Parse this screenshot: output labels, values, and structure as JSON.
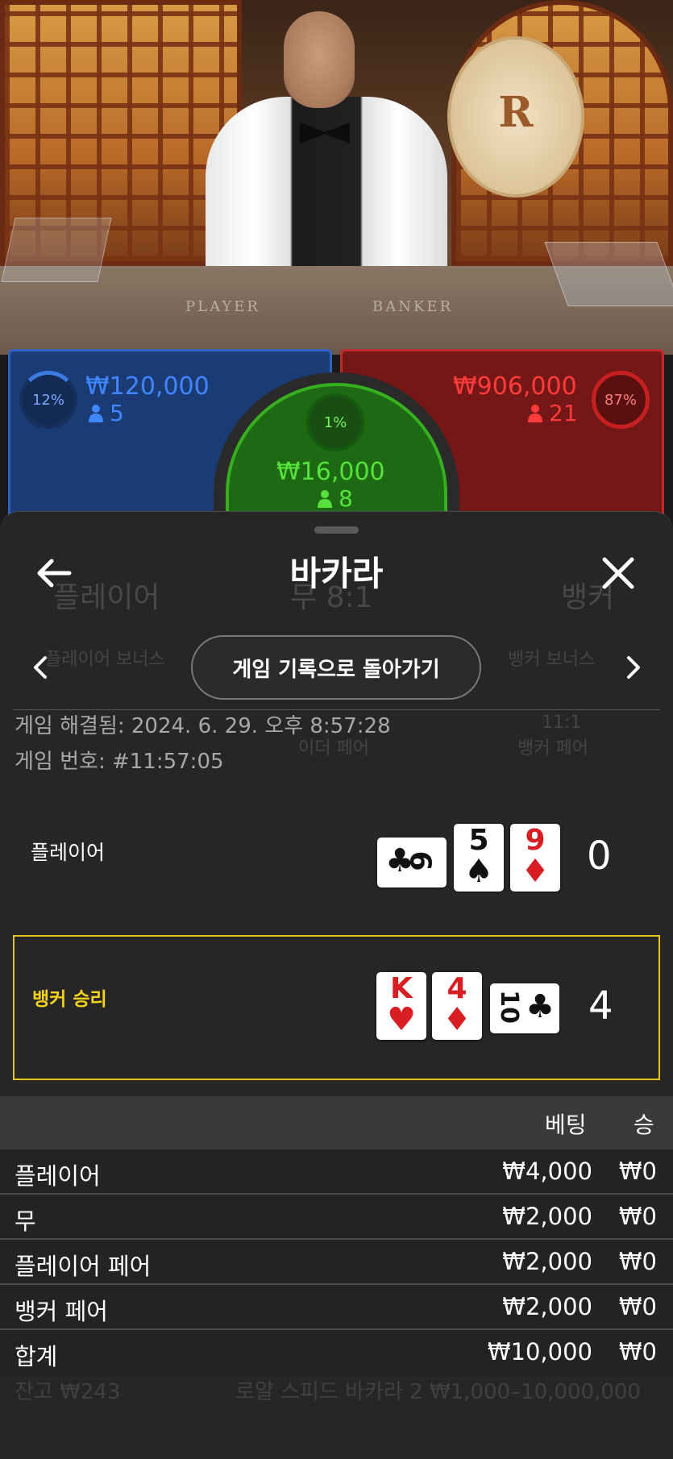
{
  "table_view": {
    "felt_player": "PLAYER",
    "felt_banker": "BANKER",
    "logo_letter": "R",
    "player_bet": {
      "percent": "12%",
      "amount": "₩120,000",
      "count": "5"
    },
    "tie_bet": {
      "percent": "1%",
      "amount": "₩16,000",
      "count": "8"
    },
    "banker_bet": {
      "percent": "87%",
      "amount": "₩906,000",
      "count": "21"
    },
    "colors": {
      "player": "#2f66c6",
      "banker": "#c42a2a",
      "tie": "#36b01e"
    }
  },
  "sheet": {
    "title": "바카라",
    "back_icon": "arrow-left-icon",
    "close_icon": "close-icon",
    "return_button": "게임 기록으로 돌아가기",
    "prev_icon": "chevron-left-icon",
    "next_icon": "chevron-right-icon",
    "meta": {
      "settled": "게임 해결됨: 2024. 6. 29. 오후 8:57:28",
      "game_number": "게임 번호: #11:57:05"
    },
    "background_labels": {
      "player": "플레이어",
      "tie": "무 8:1",
      "banker": "뱅커",
      "player_bonus": "플레이어 보너스",
      "banker_bonus": "뱅커 보너스",
      "either_pair": "이더 페어",
      "banker_pair_odds": "11:1",
      "banker_pair": "뱅커 페어",
      "footer_left": "잔고 ₩243",
      "footer_right": "로얄 스피드 바카라 2  ₩1,000–10,000,000"
    },
    "hands": [
      {
        "label": "플레이어",
        "score": "0",
        "winner": false,
        "cards": [
          {
            "rank": "6",
            "suit": "♣",
            "orientation": "horizontal"
          },
          {
            "rank": "5",
            "suit": "♠",
            "orientation": "vertical"
          },
          {
            "rank": "9",
            "suit": "♦",
            "orientation": "vertical"
          }
        ]
      },
      {
        "label": "뱅커 승리",
        "score": "4",
        "winner": true,
        "cards": [
          {
            "rank": "K",
            "suit": "♥",
            "orientation": "vertical"
          },
          {
            "rank": "4",
            "suit": "♦",
            "orientation": "vertical"
          },
          {
            "rank": "10",
            "suit": "♣",
            "orientation": "horizontal"
          }
        ]
      }
    ],
    "bets_table": {
      "headers": {
        "bet": "베팅",
        "win": "승"
      },
      "rows": [
        {
          "name": "플레이어",
          "bet": "₩4,000",
          "win": "₩0"
        },
        {
          "name": "무",
          "bet": "₩2,000",
          "win": "₩0"
        },
        {
          "name": "플레이어 페어",
          "bet": "₩2,000",
          "win": "₩0"
        },
        {
          "name": "뱅커 페어",
          "bet": "₩2,000",
          "win": "₩0"
        },
        {
          "name": "합계",
          "bet": "₩10,000",
          "win": "₩0"
        }
      ]
    }
  }
}
